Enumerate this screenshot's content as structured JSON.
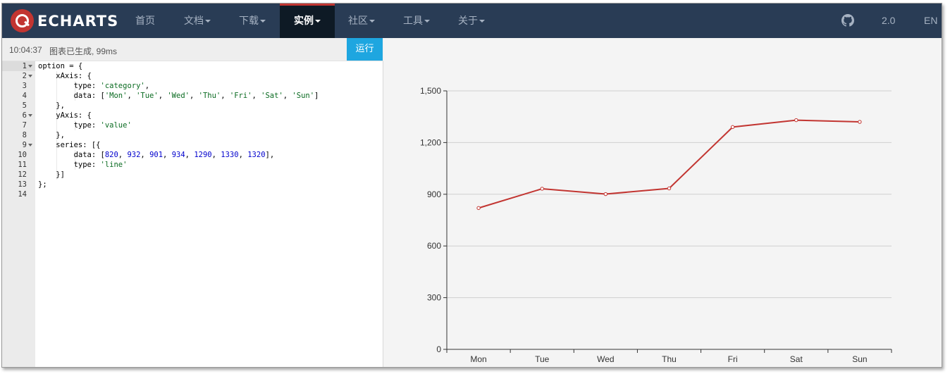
{
  "navbar": {
    "logo_text": "ECHARTS",
    "items": [
      {
        "label": "首页",
        "dropdown": false,
        "active": false
      },
      {
        "label": "文档",
        "dropdown": true,
        "active": false
      },
      {
        "label": "下载",
        "dropdown": true,
        "active": false
      },
      {
        "label": "实例",
        "dropdown": true,
        "active": true
      },
      {
        "label": "社区",
        "dropdown": true,
        "active": false
      },
      {
        "label": "工具",
        "dropdown": true,
        "active": false
      },
      {
        "label": "关于",
        "dropdown": true,
        "active": false
      }
    ],
    "version": "2.0",
    "language": "EN",
    "github_icon": "github-icon"
  },
  "toolbar": {
    "time": "10:04:37",
    "status": "图表已生成, 99ms",
    "run_label": "运行"
  },
  "editor": {
    "line_numbers": [
      "1",
      "2",
      "3",
      "4",
      "5",
      "6",
      "7",
      "8",
      "9",
      "10",
      "11",
      "12",
      "13",
      "14"
    ],
    "foldable_lines": [
      1,
      2,
      6,
      9
    ]
  },
  "colors": {
    "navbar_bg": "#293c55",
    "accent": "#c23531",
    "run_button": "#1ea6e0",
    "series": "#c23531"
  },
  "chart_data": {
    "type": "line",
    "categories": [
      "Mon",
      "Tue",
      "Wed",
      "Thu",
      "Fri",
      "Sat",
      "Sun"
    ],
    "values": [
      820,
      932,
      901,
      934,
      1290,
      1330,
      1320
    ],
    "yticks": [
      "0",
      "300",
      "600",
      "900",
      "1,200",
      "1,500"
    ],
    "ylim": [
      0,
      1500
    ],
    "grid": true,
    "title": "",
    "xlabel": "",
    "ylabel": ""
  }
}
